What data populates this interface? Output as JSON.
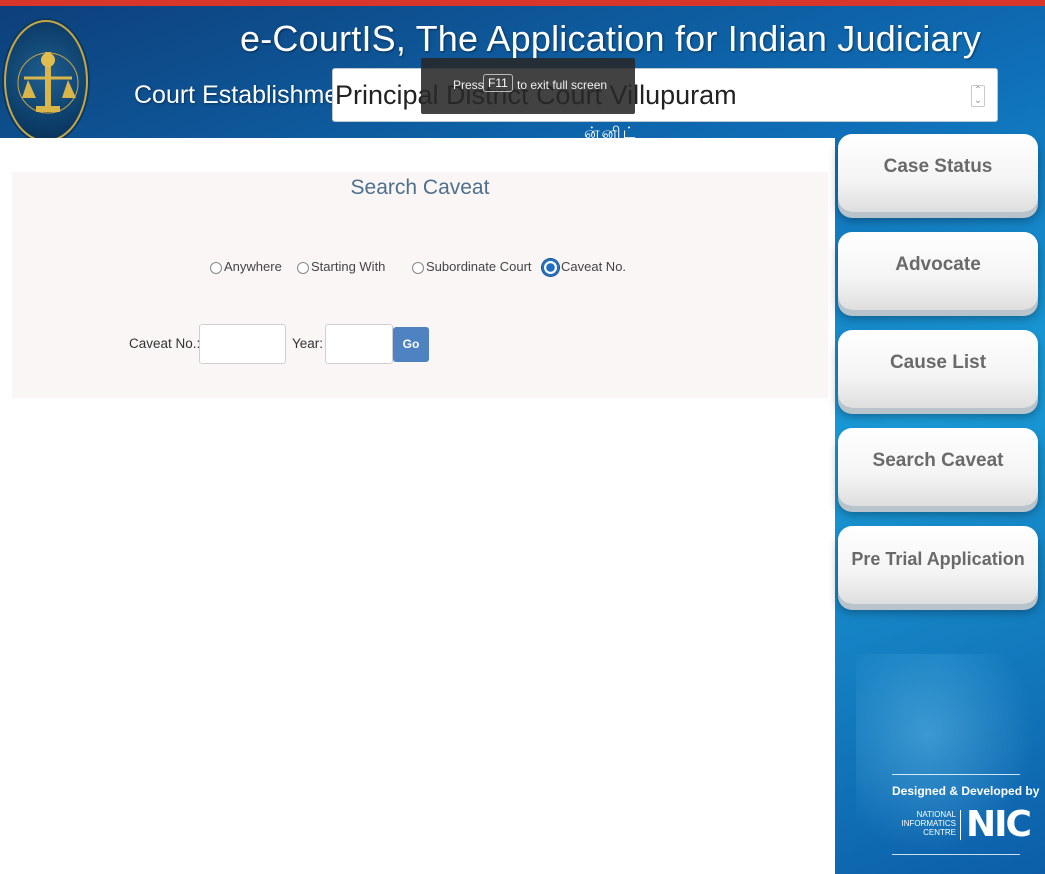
{
  "header": {
    "app_title": "e-CourtIS, The Application for Indian Judiciary",
    "establishment_label": "Court Establishment",
    "establishment_value": "Principal District Court Villupuram",
    "subtitle_fragment": "ன்னிட்"
  },
  "fullscreen_notice": {
    "press": "Press",
    "key": "F11",
    "rest": "to exit full screen"
  },
  "search": {
    "title": "Search Caveat",
    "options": [
      "Anywhere",
      "Starting With",
      "Subordinate Court",
      "Caveat No."
    ],
    "selected": "Caveat No.",
    "caveat_no_label": "Caveat No.:",
    "caveat_no_value": "",
    "year_label": "Year:",
    "year_value": "",
    "go_label": "Go"
  },
  "sidebar": {
    "items": [
      {
        "label": "Case Status"
      },
      {
        "label": "Advocate"
      },
      {
        "label": "Cause List"
      },
      {
        "label": "Search Caveat"
      },
      {
        "label": "Pre Trial Application"
      }
    ]
  },
  "footer": {
    "designed_by": "Designed & Developed by",
    "nic_line1": "NATIONAL",
    "nic_line2": "INFORMATICS",
    "nic_line3": "CENTRE",
    "nic_logo": "NIC"
  },
  "colors": {
    "accent_red": "#d8362a",
    "brand_blue": "#0f6fb8",
    "go_button": "#4f82c0",
    "selected_radio": "#1f6ec2"
  }
}
